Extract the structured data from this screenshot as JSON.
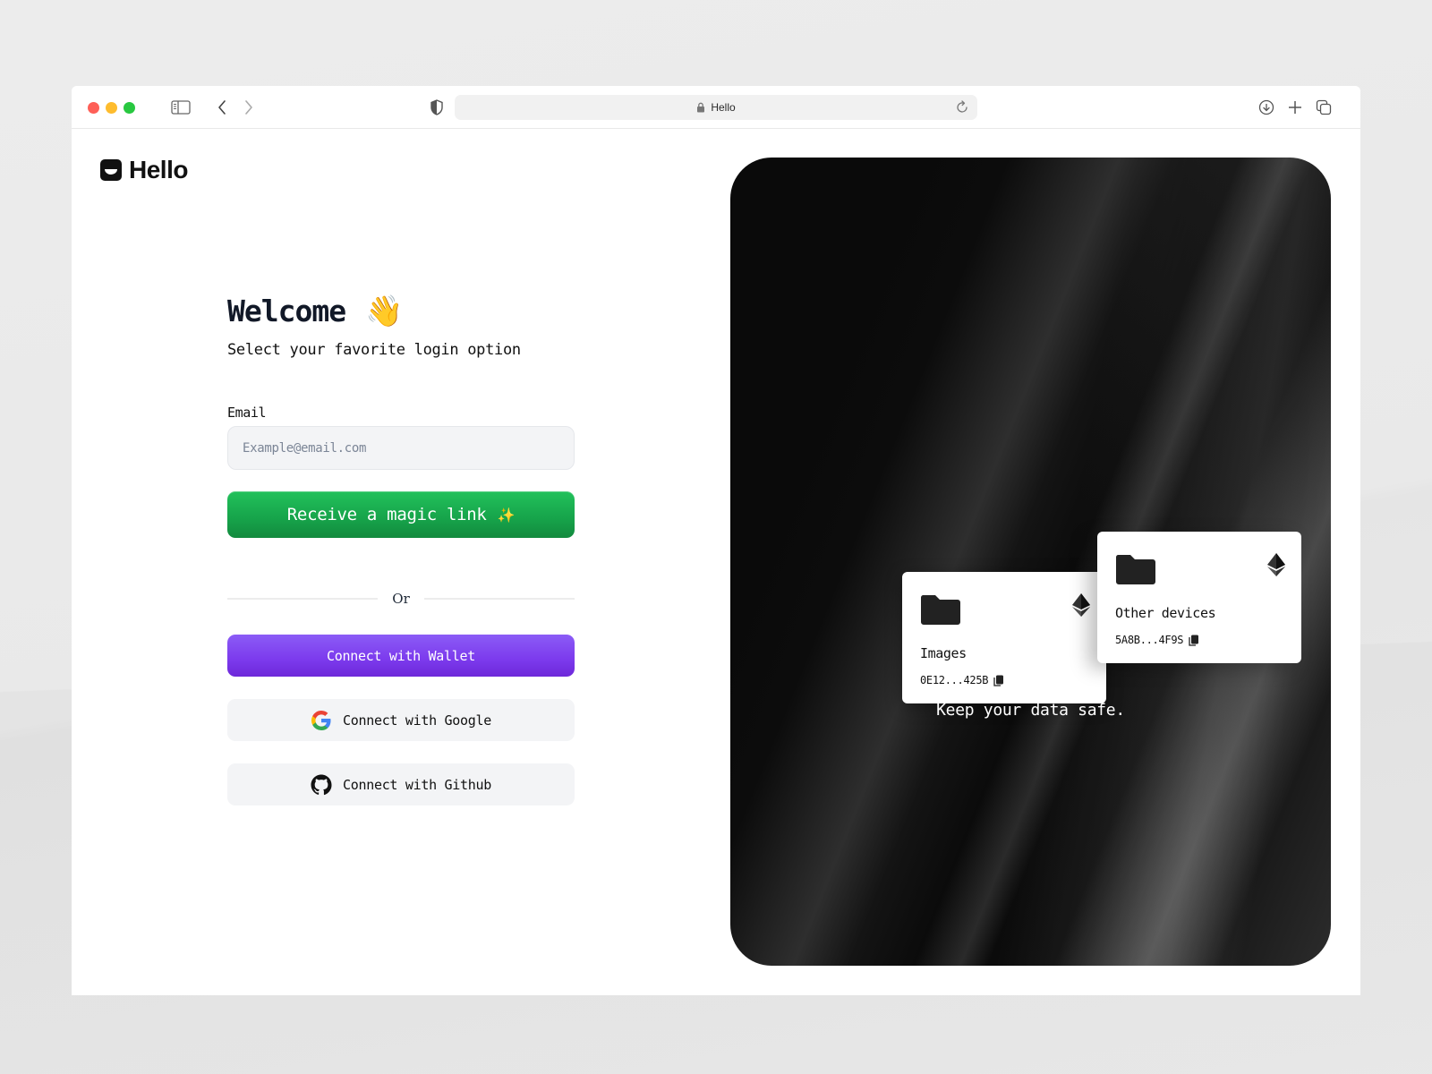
{
  "browser": {
    "url_text": "Hello",
    "icons": [
      "sidebar-toggle-icon",
      "back-icon",
      "forward-icon",
      "shield-icon",
      "lock-icon",
      "reload-icon",
      "download-icon",
      "plus-icon",
      "tabs-icon"
    ]
  },
  "brand": {
    "name": "Hello"
  },
  "login": {
    "title": "Welcome",
    "title_emoji": "👋",
    "subtitle": "Select your favorite login option",
    "email_label": "Email",
    "email_value": "",
    "email_placeholder": "Example@email.com",
    "magic_link_label": "Receive a magic link",
    "magic_link_emoji": "✨",
    "divider_label": "Or",
    "wallet_label": "Connect with Wallet",
    "google_label": "Connect with Google",
    "github_label": "Connect with Github"
  },
  "showcase": {
    "cards": [
      {
        "title": "Images",
        "id": "0E12...425B"
      },
      {
        "title": "Other devices",
        "id": "5A8B...4F9S"
      }
    ],
    "tagline": "Keep your data safe."
  },
  "colors": {
    "magic_link_green": "#16a34a",
    "wallet_purple": "#7c3aed",
    "social_button_bg": "#f3f4f6",
    "panel_bg": "#0a0a0a"
  }
}
